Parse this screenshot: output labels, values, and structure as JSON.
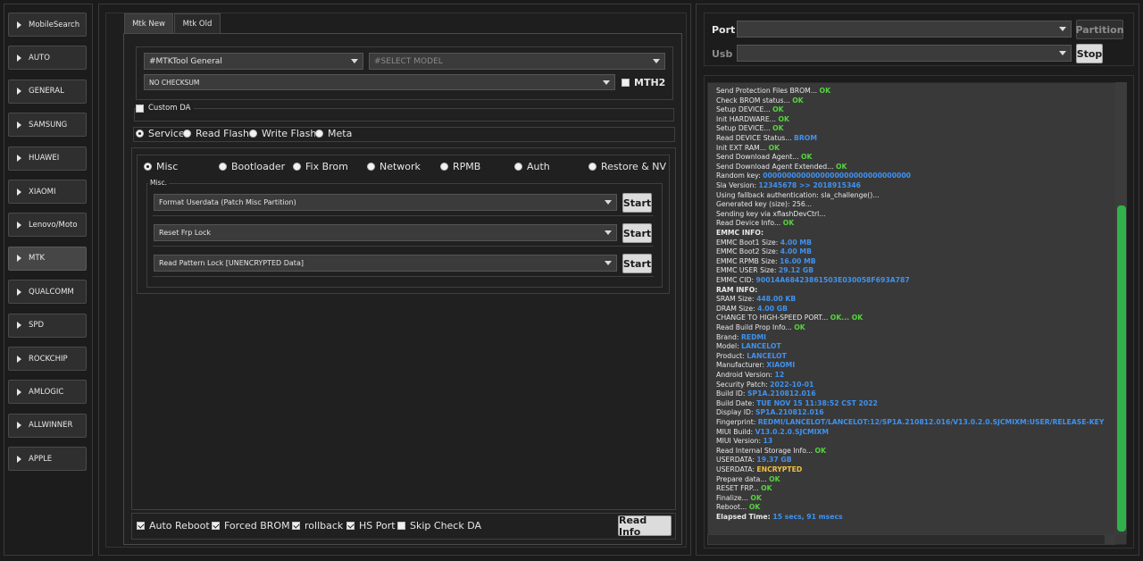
{
  "sidebar": {
    "items": [
      {
        "label": "MobileSearch"
      },
      {
        "label": "AUTO"
      },
      {
        "label": "GENERAL"
      },
      {
        "label": "SAMSUNG"
      },
      {
        "label": "HUAWEI"
      },
      {
        "label": "XIAOMI"
      },
      {
        "label": "Lenovo/Moto"
      },
      {
        "label": "MTK"
      },
      {
        "label": "QUALCOMM"
      },
      {
        "label": "SPD"
      },
      {
        "label": "ROCKCHIP"
      },
      {
        "label": "AMLOGIC"
      },
      {
        "label": "ALLWINNER"
      },
      {
        "label": "APPLE"
      }
    ],
    "active": "MTK"
  },
  "tabs": [
    {
      "label": "Mtk New"
    },
    {
      "label": "Mtk Old"
    }
  ],
  "config": {
    "tool_select": "#MTKTool General",
    "model_select": "#SELECT MODEL",
    "checksum_select": "NO CHECKSUM",
    "mth2_label": "MTH2",
    "custom_da_label": "Custom DA"
  },
  "modes": {
    "selected": "Service",
    "options": [
      "Service",
      "Read Flash",
      "Write Flash",
      "Meta"
    ]
  },
  "functions": {
    "selected": "Misc",
    "options": [
      "Misc",
      "Bootloader",
      "Fix Brom",
      "Network",
      "RPMB",
      "Auth",
      "Restore & NV"
    ]
  },
  "misc": {
    "group_label": "Misc.",
    "rows": [
      {
        "select": "Format Userdata (Patch Misc Partition)",
        "button": "Start"
      },
      {
        "select": "Reset Frp Lock",
        "button": "Start"
      },
      {
        "select": "Read Pattern Lock [UNENCRYPTED Data]",
        "button": "Start"
      }
    ]
  },
  "options_bar": {
    "items": [
      {
        "label": "Auto Reboot",
        "checked": true
      },
      {
        "label": "Forced BROM",
        "checked": true
      },
      {
        "label": "rollback",
        "checked": true
      },
      {
        "label": "HS Port",
        "checked": true
      },
      {
        "label": "Skip Check DA",
        "checked": false
      }
    ],
    "read_info": "Read Info"
  },
  "connection": {
    "port_label": "Port",
    "usb_label": "Usb",
    "port_value": "",
    "usb_value": "",
    "partition_button": "Partition",
    "stop_button": "Stop"
  },
  "log": {
    "lines": [
      {
        "k": "Send Protection Files BROM... ",
        "v": "OK",
        "c": "ok"
      },
      {
        "k": "Check BROM status... ",
        "v": "OK",
        "c": "ok"
      },
      {
        "k": "Setup DEVICE... ",
        "v": "OK",
        "c": "ok"
      },
      {
        "k": "Init HARDWARE... ",
        "v": "OK",
        "c": "ok"
      },
      {
        "k": "Setup DEVICE... ",
        "v": "OK",
        "c": "ok"
      },
      {
        "k": "Read DEVICE Status... ",
        "v": "BROM",
        "c": "blue"
      },
      {
        "k": "Init EXT RAM... ",
        "v": "OK",
        "c": "ok"
      },
      {
        "k": "Send Download Agent... ",
        "v": "OK",
        "c": "ok"
      },
      {
        "k": "Send Download Agent Extended... ",
        "v": "OK",
        "c": "ok"
      },
      {
        "k": "Random key:  ",
        "v": "0000000000000000000000000000000",
        "c": "blue"
      },
      {
        "k": "Sla Version:  ",
        "v": "12345678  >> 2018915346",
        "c": "blue"
      },
      {
        "k": "Using fallback authentication: sla_challenge()...",
        "v": "",
        "c": ""
      },
      {
        "k": "Generated key (size): 256...",
        "v": "",
        "c": ""
      },
      {
        "k": "Sending key via xflashDevCtrl...",
        "v": "",
        "c": ""
      },
      {
        "k": "Read Device Info... ",
        "v": "OK",
        "c": "ok"
      },
      {
        "k": "EMMC INFO:",
        "v": "",
        "c": "",
        "bold": true
      },
      {
        "k": "EMMC Boot1 Size: ",
        "v": "4.00 MB",
        "c": "blue"
      },
      {
        "k": "EMMC Boot2 Size: ",
        "v": "4.00 MB",
        "c": "blue"
      },
      {
        "k": "EMMC RPMB Size: ",
        "v": "16.00 MB",
        "c": "blue"
      },
      {
        "k": "EMMC USER Size: ",
        "v": "29.12 GB",
        "c": "blue"
      },
      {
        "k": "EMMC CID: ",
        "v": "90014A68423861503E030058F693A787",
        "c": "blue"
      },
      {
        "k": "RAM INFO:",
        "v": "",
        "c": "",
        "bold": true
      },
      {
        "k": "SRAM Size: ",
        "v": "448.00 KB",
        "c": "blue"
      },
      {
        "k": "DRAM Size: ",
        "v": "4.00 GB",
        "c": "blue"
      },
      {
        "k": "CHANGE TO HIGH-SPEED PORT... ",
        "v": "OK... OK",
        "c": "ok"
      },
      {
        "k": "Read Build Prop Info... ",
        "v": "OK",
        "c": "ok"
      },
      {
        "k": " Brand: ",
        "v": "REDMI",
        "c": "blue"
      },
      {
        "k": " Model: ",
        "v": "LANCELOT",
        "c": "blue"
      },
      {
        "k": " Product: ",
        "v": "LANCELOT",
        "c": "blue"
      },
      {
        "k": " Manufacturer: ",
        "v": "XIAOMI",
        "c": "blue"
      },
      {
        "k": " Android Version: ",
        "v": "12",
        "c": "blue"
      },
      {
        "k": " Security Patch: ",
        "v": "2022-10-01",
        "c": "blue"
      },
      {
        "k": " Build ID: ",
        "v": "SP1A.210812.016",
        "c": "blue"
      },
      {
        "k": " Build Date: ",
        "v": "TUE NOV 15 11:38:52 CST 2022",
        "c": "blue"
      },
      {
        "k": " Display ID: ",
        "v": "SP1A.210812.016",
        "c": "blue"
      },
      {
        "k": " Fingerprint: ",
        "v": "REDMI/LANCELOT/LANCELOT:12/SP1A.210812.016/V13.0.2.0.SJCMIXM:USER/RELEASE-KEY",
        "c": "blue"
      },
      {
        "k": " MIUI Build: ",
        "v": "V13.0.2.0.SJCMIXM",
        "c": "blue"
      },
      {
        "k": " MIUI Version: ",
        "v": "13",
        "c": "blue"
      },
      {
        "k": "Read Internal Storage Info... ",
        "v": "OK",
        "c": "ok"
      },
      {
        "k": "USERDATA: ",
        "v": "19.37 GB",
        "c": "blue"
      },
      {
        "k": "USERDATA: ",
        "v": "ENCRYPTED",
        "c": "yellow"
      },
      {
        "k": "Prepare data... ",
        "v": "OK",
        "c": "ok"
      },
      {
        "k": "RESET FRP... ",
        "v": "OK",
        "c": "ok"
      },
      {
        "k": "Finalize... ",
        "v": "OK",
        "c": "ok"
      },
      {
        "k": "Reboot... ",
        "v": "OK",
        "c": "ok"
      },
      {
        "k": "Elapsed Time: ",
        "v": "15 secs, 91 msecs",
        "c": "blue",
        "bold": true
      }
    ]
  },
  "colors": {
    "ok": "#56d33c",
    "info": "#3f92f0",
    "warning": "#f0c040",
    "scrollbar": "#2fb24a"
  }
}
